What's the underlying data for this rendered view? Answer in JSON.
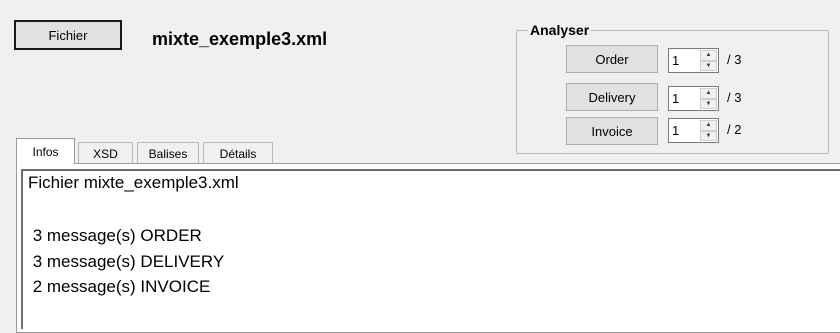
{
  "header": {
    "fichier_button": "Fichier",
    "file_name": "mixte_exemple3.xml"
  },
  "analyser": {
    "legend": "Analyser",
    "rows": [
      {
        "label": "Order",
        "value": "1",
        "max": "/ 3"
      },
      {
        "label": "Delivery",
        "value": "1",
        "max": "/ 3"
      },
      {
        "label": "Invoice",
        "value": "1",
        "max": "/ 2"
      }
    ]
  },
  "tabs": [
    {
      "label": "Infos",
      "active": true
    },
    {
      "label": "XSD",
      "active": false
    },
    {
      "label": "Balises",
      "active": false
    },
    {
      "label": "Détails",
      "active": false
    }
  ],
  "content": {
    "lines": [
      "Fichier mixte_exemple3.xml",
      "",
      " 3 message(s) ORDER",
      " 3 message(s) DELIVERY",
      " 2 message(s) INVOICE"
    ]
  }
}
